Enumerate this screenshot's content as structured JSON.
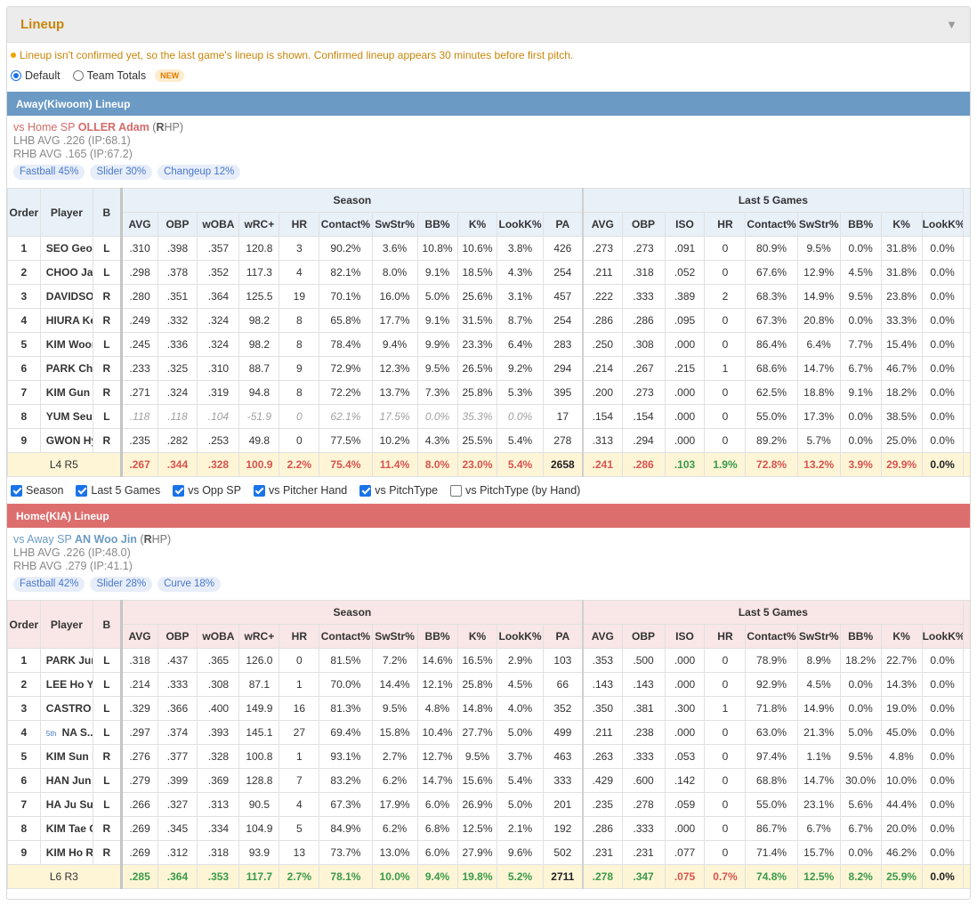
{
  "panel": {
    "title": "Lineup",
    "toggle_icon": "▼"
  },
  "notice": "Lineup isn't confirmed yet, so the last game's lineup is shown. Confirmed lineup appears 30 minutes before first pitch.",
  "modes": {
    "default": "Default",
    "team_totals": "Team Totals",
    "new_badge": "NEW",
    "selected": "Default"
  },
  "headers": {
    "order": "Order",
    "player": "Player",
    "b": "B",
    "season": "Season",
    "last5": "Last 5 Games",
    "season_cols": [
      "AVG",
      "OBP",
      "wOBA",
      "wRC+",
      "HR",
      "Contact%",
      "SwStr%",
      "BB%",
      "K%",
      "LookK%",
      "PA"
    ],
    "last5_cols": [
      "AVG",
      "OBP",
      "ISO",
      "HR",
      "Contact%",
      "SwStr%",
      "BB%",
      "K%",
      "LookK%"
    ]
  },
  "away": {
    "title": "Away(Kiwoom) Lineup",
    "vs_prefix": "vs Home SP ",
    "sp_name": "OLLER Adam",
    "sp_hand_open": " (",
    "sp_hand_letter": "R",
    "sp_hand_rest": "HP)",
    "lhb": "LHB AVG .226 (IP:68.1)",
    "rhb": "RHB AVG .165 (IP:67.2)",
    "pitches": [
      "Fastball 45%",
      "Slider 30%",
      "Changeup 12%"
    ],
    "rows": [
      {
        "order": "1",
        "player": "SEO Geon ...",
        "b": "L",
        "season": [
          ".310",
          ".398",
          ".357",
          "120.8",
          "3",
          "90.2%",
          "3.6%",
          "10.8%",
          "10.6%",
          "3.8%",
          "426"
        ],
        "last5": [
          ".273",
          ".273",
          ".091",
          "0",
          "80.9%",
          "9.5%",
          "0.0%",
          "31.8%",
          "0.0%"
        ]
      },
      {
        "order": "2",
        "player": "CHOO Jae...",
        "b": "L",
        "season": [
          ".298",
          ".378",
          ".352",
          "117.3",
          "4",
          "82.1%",
          "8.0%",
          "9.1%",
          "18.5%",
          "4.3%",
          "254"
        ],
        "last5": [
          ".211",
          ".318",
          ".052",
          "0",
          "67.6%",
          "12.9%",
          "4.5%",
          "31.8%",
          "0.0%"
        ]
      },
      {
        "order": "3",
        "player": "DAVIDSON...",
        "b": "R",
        "season": [
          ".280",
          ".351",
          ".364",
          "125.5",
          "19",
          "70.1%",
          "16.0%",
          "5.0%",
          "25.6%",
          "3.1%",
          "457"
        ],
        "last5": [
          ".222",
          ".333",
          ".389",
          "2",
          "68.3%",
          "14.9%",
          "9.5%",
          "23.8%",
          "0.0%"
        ]
      },
      {
        "order": "4",
        "player": "HIURA Kes...",
        "b": "R",
        "season": [
          ".249",
          ".332",
          ".324",
          "98.2",
          "8",
          "65.8%",
          "17.7%",
          "9.1%",
          "31.5%",
          "8.7%",
          "254"
        ],
        "last5": [
          ".286",
          ".286",
          ".095",
          "0",
          "67.3%",
          "20.8%",
          "0.0%",
          "33.3%",
          "0.0%"
        ]
      },
      {
        "order": "5",
        "player": "KIM Woon...",
        "b": "L",
        "season": [
          ".245",
          ".336",
          ".324",
          "98.2",
          "8",
          "78.4%",
          "9.4%",
          "9.9%",
          "23.3%",
          "6.4%",
          "283"
        ],
        "last5": [
          ".250",
          ".308",
          ".000",
          "0",
          "86.4%",
          "6.4%",
          "7.7%",
          "15.4%",
          "0.0%"
        ]
      },
      {
        "order": "6",
        "player": "PARK Cha...",
        "b": "R",
        "season": [
          ".233",
          ".325",
          ".310",
          "88.7",
          "9",
          "72.9%",
          "12.3%",
          "9.5%",
          "26.5%",
          "9.2%",
          "294"
        ],
        "last5": [
          ".214",
          ".267",
          ".215",
          "1",
          "68.6%",
          "14.7%",
          "6.7%",
          "46.7%",
          "0.0%"
        ]
      },
      {
        "order": "7",
        "player": "KIM Gun H...",
        "b": "R",
        "season": [
          ".271",
          ".324",
          ".319",
          "94.8",
          "8",
          "72.2%",
          "13.7%",
          "7.3%",
          "25.8%",
          "5.3%",
          "395"
        ],
        "last5": [
          ".200",
          ".273",
          ".000",
          "0",
          "62.5%",
          "18.8%",
          "9.1%",
          "18.2%",
          "0.0%"
        ]
      },
      {
        "order": "8",
        "player": "YUM Seun...",
        "b": "L",
        "grayed": true,
        "season": [
          ".118",
          ".118",
          ".104",
          "-51.9",
          "0",
          "62.1%",
          "17.5%",
          "0.0%",
          "35.3%",
          "0.0%",
          "17"
        ],
        "last5": [
          ".154",
          ".154",
          ".000",
          "0",
          "55.0%",
          "17.3%",
          "0.0%",
          "38.5%",
          "0.0%"
        ]
      },
      {
        "order": "9",
        "player": "GWON Hy...",
        "b": "R",
        "season": [
          ".235",
          ".282",
          ".253",
          "49.8",
          "0",
          "77.5%",
          "10.2%",
          "4.3%",
          "25.5%",
          "5.4%",
          "278"
        ],
        "last5": [
          ".313",
          ".294",
          ".000",
          "0",
          "89.2%",
          "5.7%",
          "0.0%",
          "25.0%",
          "0.0%"
        ]
      }
    ],
    "totals": {
      "label": "L4 R5",
      "season": [
        ".267",
        ".344",
        ".328",
        "100.9",
        "2.2%",
        "75.4%",
        "11.4%",
        "8.0%",
        "23.0%",
        "5.4%",
        "2658"
      ],
      "season_colors": [
        "red",
        "red",
        "red",
        "red",
        "red",
        "red",
        "red",
        "red",
        "red",
        "red",
        "blk"
      ],
      "last5": [
        ".241",
        ".286",
        ".103",
        "1.9%",
        "72.8%",
        "13.2%",
        "3.9%",
        "29.9%",
        "0.0%"
      ],
      "last5_colors": [
        "red",
        "red",
        "green",
        "green",
        "red",
        "red",
        "red",
        "red",
        "blk"
      ]
    }
  },
  "filters": [
    {
      "label": "Season",
      "checked": true
    },
    {
      "label": "Last 5 Games",
      "checked": true
    },
    {
      "label": "vs Opp SP",
      "checked": true
    },
    {
      "label": "vs Pitcher Hand",
      "checked": true
    },
    {
      "label": "vs PitchType",
      "checked": true
    },
    {
      "label": "vs PitchType (by Hand)",
      "checked": false
    }
  ],
  "home": {
    "title": "Home(KIA) Lineup",
    "vs_prefix": "vs Away SP ",
    "sp_name": "AN Woo Jin",
    "sp_hand_open": " (",
    "sp_hand_letter": "R",
    "sp_hand_rest": "HP)",
    "lhb": "LHB AVG .226 (IP:48.0)",
    "rhb": "RHB AVG .279 (IP:41.1)",
    "pitches": [
      "Fastball 42%",
      "Slider 28%",
      "Curve 18%"
    ],
    "rows": [
      {
        "order": "1",
        "player": "PARK Jun...",
        "b": "L",
        "season": [
          ".318",
          ".437",
          ".365",
          "126.0",
          "0",
          "81.5%",
          "7.2%",
          "14.6%",
          "16.5%",
          "2.9%",
          "103"
        ],
        "last5": [
          ".353",
          ".500",
          ".000",
          "0",
          "78.9%",
          "8.9%",
          "18.2%",
          "22.7%",
          "0.0%"
        ]
      },
      {
        "order": "2",
        "player": "LEE Ho Yeon",
        "b": "L",
        "season": [
          ".214",
          ".333",
          ".308",
          "87.1",
          "1",
          "70.0%",
          "14.4%",
          "12.1%",
          "25.8%",
          "4.5%",
          "66"
        ],
        "last5": [
          ".143",
          ".143",
          ".000",
          "0",
          "92.9%",
          "4.5%",
          "0.0%",
          "14.3%",
          "0.0%"
        ]
      },
      {
        "order": "3",
        "player": "CASTRO H...",
        "b": "L",
        "season": [
          ".329",
          ".366",
          ".400",
          "149.9",
          "16",
          "81.3%",
          "9.5%",
          "4.8%",
          "14.8%",
          "4.0%",
          "352"
        ],
        "last5": [
          ".350",
          ".381",
          ".300",
          "1",
          "71.8%",
          "14.9%",
          "0.0%",
          "19.0%",
          "0.0%"
        ]
      },
      {
        "order": "4",
        "player": "NA S...",
        "tag": "5th",
        "b": "L",
        "season": [
          ".297",
          ".374",
          ".393",
          "145.1",
          "27",
          "69.4%",
          "15.8%",
          "10.4%",
          "27.7%",
          "5.0%",
          "499"
        ],
        "last5": [
          ".211",
          ".238",
          ".000",
          "0",
          "63.0%",
          "21.3%",
          "5.0%",
          "45.0%",
          "0.0%"
        ]
      },
      {
        "order": "5",
        "player": "KIM Sun Bin",
        "b": "R",
        "season": [
          ".276",
          ".377",
          ".328",
          "100.8",
          "1",
          "93.1%",
          "2.7%",
          "12.7%",
          "9.5%",
          "3.7%",
          "463"
        ],
        "last5": [
          ".263",
          ".333",
          ".053",
          "0",
          "97.4%",
          "1.1%",
          "9.5%",
          "4.8%",
          "0.0%"
        ]
      },
      {
        "order": "6",
        "player": "HAN Jun Su",
        "b": "L",
        "season": [
          ".279",
          ".399",
          ".369",
          "128.8",
          "7",
          "83.2%",
          "6.2%",
          "14.7%",
          "15.6%",
          "5.4%",
          "333"
        ],
        "last5": [
          ".429",
          ".600",
          ".142",
          "0",
          "68.8%",
          "14.7%",
          "30.0%",
          "10.0%",
          "0.0%"
        ]
      },
      {
        "order": "7",
        "player": "HA Ju Suk",
        "b": "L",
        "season": [
          ".266",
          ".327",
          ".313",
          "90.5",
          "4",
          "67.3%",
          "17.9%",
          "6.0%",
          "26.9%",
          "5.0%",
          "201"
        ],
        "last5": [
          ".235",
          ".278",
          ".059",
          "0",
          "55.0%",
          "23.1%",
          "5.6%",
          "44.4%",
          "0.0%"
        ]
      },
      {
        "order": "8",
        "player": "KIM Tae Gun",
        "b": "R",
        "season": [
          ".269",
          ".345",
          ".334",
          "104.9",
          "5",
          "84.9%",
          "6.2%",
          "6.8%",
          "12.5%",
          "2.1%",
          "192"
        ],
        "last5": [
          ".286",
          ".333",
          ".000",
          "0",
          "86.7%",
          "6.7%",
          "6.7%",
          "20.0%",
          "0.0%"
        ]
      },
      {
        "order": "9",
        "player": "KIM Ho Ry...",
        "b": "R",
        "season": [
          ".269",
          ".312",
          ".318",
          "93.9",
          "13",
          "73.7%",
          "13.0%",
          "6.0%",
          "27.9%",
          "9.6%",
          "502"
        ],
        "last5": [
          ".231",
          ".231",
          ".077",
          "0",
          "71.4%",
          "15.7%",
          "0.0%",
          "46.2%",
          "0.0%"
        ]
      }
    ],
    "totals": {
      "label": "L6 R3",
      "season": [
        ".285",
        ".364",
        ".353",
        "117.7",
        "2.7%",
        "78.1%",
        "10.0%",
        "9.4%",
        "19.8%",
        "5.2%",
        "2711"
      ],
      "season_colors": [
        "green",
        "green",
        "green",
        "green",
        "green",
        "green",
        "green",
        "green",
        "green",
        "green",
        "blk"
      ],
      "last5": [
        ".278",
        ".347",
        ".075",
        "0.7%",
        "74.8%",
        "12.5%",
        "8.2%",
        "25.9%",
        "0.0%"
      ],
      "last5_colors": [
        "green",
        "green",
        "red",
        "red",
        "green",
        "green",
        "green",
        "green",
        "blk"
      ]
    }
  },
  "colors": {
    "accent": "#c8860a",
    "away_bar": "#6b9ac4",
    "home_bar": "#dd6e6e",
    "totals_bg": "#fdf5d6",
    "good": "#3a9a4a",
    "bad": "#d9534f"
  }
}
